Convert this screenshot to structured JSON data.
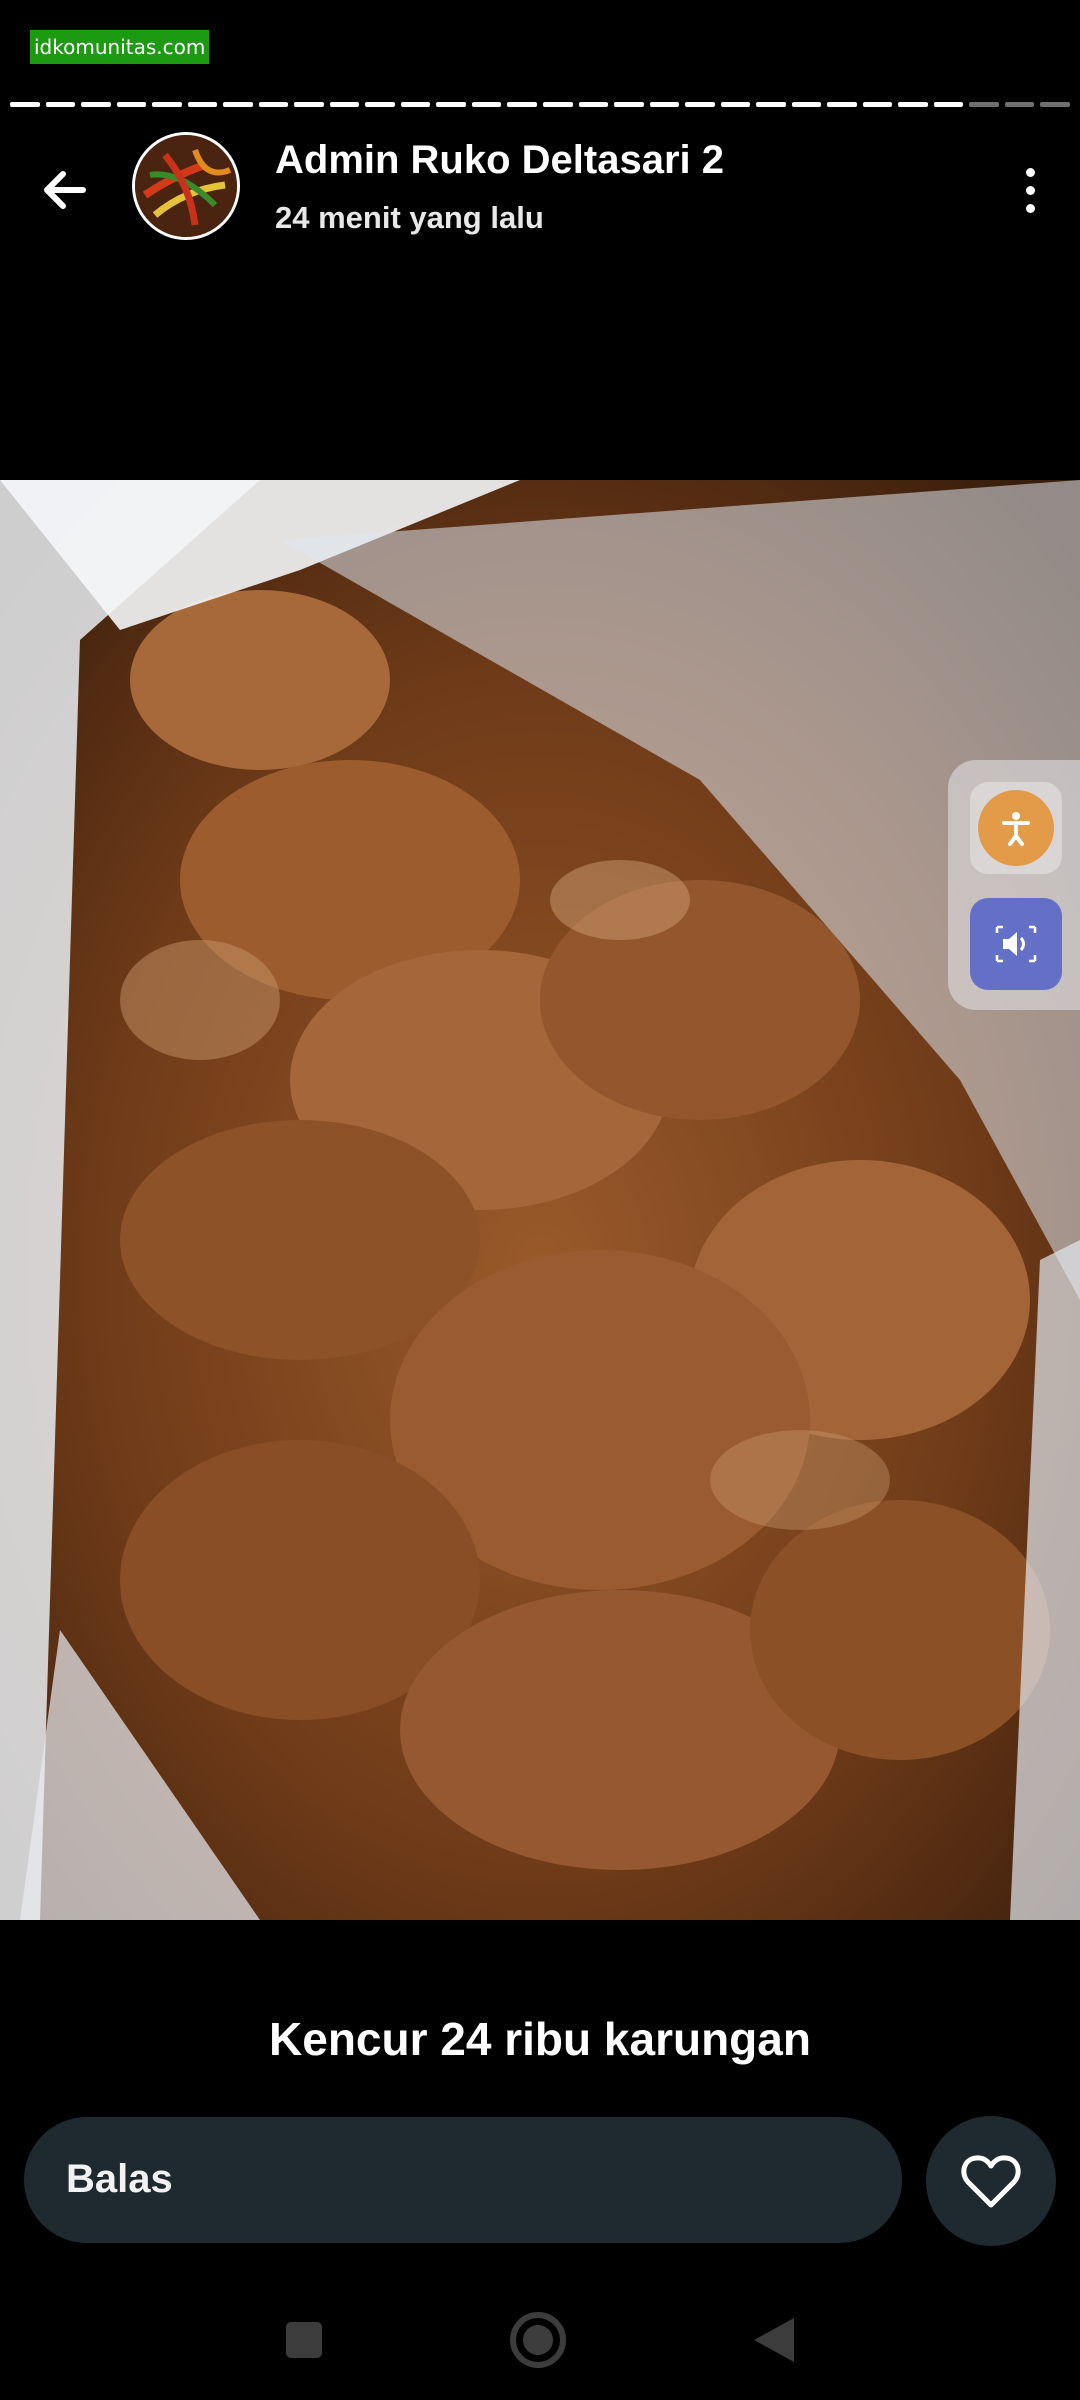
{
  "watermark": "idkomunitas.com",
  "story": {
    "segments_total": 30,
    "segments_viewed": 27
  },
  "header": {
    "back_icon": "arrow-left-icon",
    "author": "Admin Ruko Deltasari 2",
    "time": "24 menit yang lalu",
    "menu_icon": "more-vertical-icon"
  },
  "overlay": {
    "accessibility_icon": "accessibility-icon",
    "sound_icon": "volume-icon"
  },
  "caption": "Kencur 24 ribu karungan",
  "reply": {
    "label": "Balas",
    "like_icon": "heart-icon"
  },
  "system_nav": {
    "recent_icon": "square-icon",
    "home_icon": "circle-icon",
    "back_icon": "triangle-back-icon"
  },
  "colors": {
    "background": "#000000",
    "input_bg": "#1f2a30",
    "watermark_bg": "#1c9b12",
    "accessibility": "#e39b4a",
    "sound": "#6470c8"
  }
}
